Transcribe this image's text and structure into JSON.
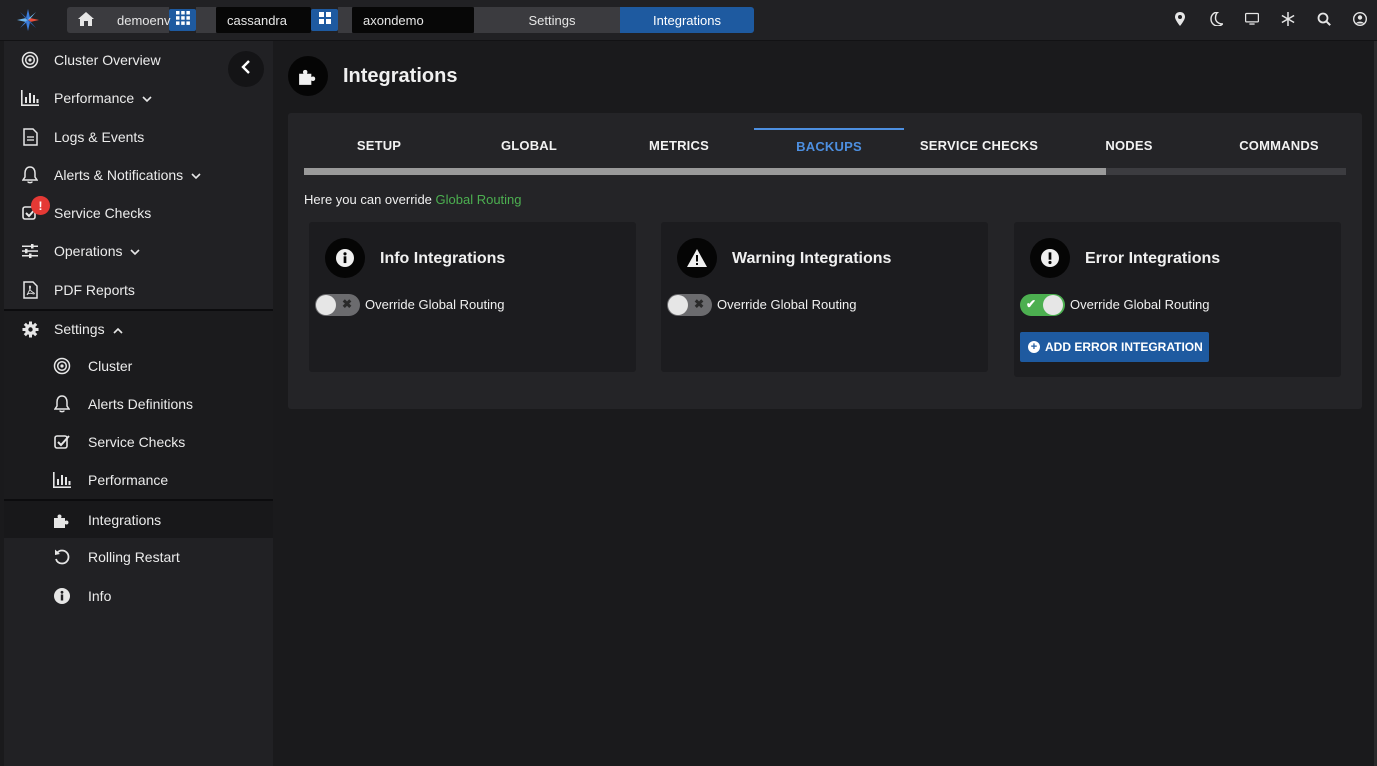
{
  "topbar": {
    "crumbs": {
      "env": "demoenv",
      "cluster_type": "cassandra",
      "cluster": "axondemo",
      "settings": "Settings",
      "current": "Integrations"
    },
    "icons": [
      "map-pin-icon",
      "moon-icon",
      "monitor-icon",
      "snowflake-icon",
      "search-icon",
      "user-icon"
    ]
  },
  "sidebar": {
    "items": [
      {
        "label": "Cluster Overview",
        "icon": "target-icon"
      },
      {
        "label": "Performance",
        "icon": "bar-chart-icon"
      },
      {
        "label": "Logs & Events",
        "icon": "document-icon"
      },
      {
        "label": "Alerts & Notifications",
        "icon": "bell-icon"
      },
      {
        "label": "Service Checks",
        "icon": "checkbox-icon",
        "badge": "!"
      },
      {
        "label": "Operations",
        "icon": "sliders-icon"
      },
      {
        "label": "PDF Reports",
        "icon": "pdf-icon"
      },
      {
        "label": "Settings",
        "icon": "gear-icon"
      }
    ],
    "sub_items": [
      {
        "label": "Cluster",
        "icon": "target-icon"
      },
      {
        "label": "Alerts Definitions",
        "icon": "bell-icon"
      },
      {
        "label": "Service Checks",
        "icon": "checkbox-icon"
      },
      {
        "label": "Performance",
        "icon": "bar-chart-icon"
      },
      {
        "label": "Integrations",
        "icon": "puzzle-icon"
      },
      {
        "label": "Rolling Restart",
        "icon": "restart-icon"
      },
      {
        "label": "Info",
        "icon": "info-icon"
      }
    ]
  },
  "page": {
    "title": "Integrations",
    "tabs": [
      "SETUP",
      "GLOBAL",
      "METRICS",
      "BACKUPS",
      "SERVICE CHECKS",
      "NODES",
      "COMMANDS"
    ],
    "active_tab": "BACKUPS",
    "tab_scroll_fraction": 0.77,
    "intro_text": "Here you can override ",
    "intro_link": "Global Routing",
    "cards": [
      {
        "title": "Info Integrations",
        "icon": "info-icon",
        "toggle_label": "Override Global Routing",
        "toggle_on": false
      },
      {
        "title": "Warning Integrations",
        "icon": "warning-icon",
        "toggle_label": "Override Global Routing",
        "toggle_on": false
      },
      {
        "title": "Error Integrations",
        "icon": "error-icon",
        "toggle_label": "Override Global Routing",
        "toggle_on": true,
        "button_label": "ADD ERROR INTEGRATION"
      }
    ]
  },
  "colors": {
    "accent_blue": "#1e5aa0",
    "active_tab": "#4d8fe0",
    "link_green": "#4caf50",
    "badge_red": "#e53935"
  }
}
